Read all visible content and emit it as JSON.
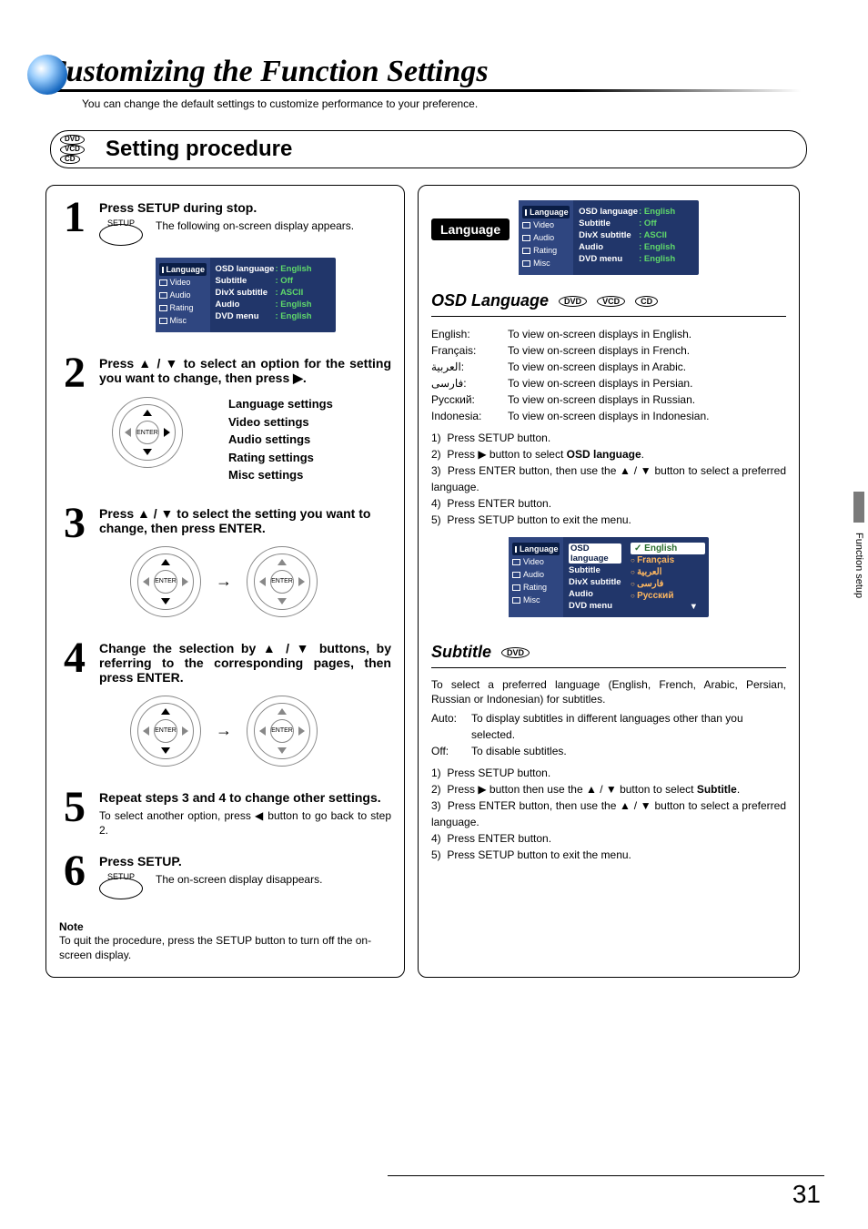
{
  "page_number": "31",
  "side_tab": "Function setup",
  "heading": {
    "title": "Customizing the Function Settings",
    "subtitle": "You can change the default settings to customize performance to your preference.",
    "section": "Setting procedure",
    "disc_types": [
      "DVD",
      "VCD",
      "CD"
    ]
  },
  "left_column": {
    "step1": {
      "num": "1",
      "title": "Press SETUP during stop.",
      "text": "The following on-screen display appears.",
      "btn_label": "SETUP"
    },
    "step2": {
      "num": "2",
      "title": "Press ▲ / ▼ to select an option for the setting you want to change, then press ▶.",
      "list": [
        "Language settings",
        "Video settings",
        "Audio settings",
        "Rating settings",
        "Misc settings"
      ]
    },
    "step3": {
      "num": "3",
      "title": "Press ▲ / ▼ to select the setting you want to change, then press ENTER."
    },
    "step4": {
      "num": "4",
      "title": "Change the selection by ▲ / ▼ buttons, by referring to the corresponding pages, then press ENTER."
    },
    "step5": {
      "num": "5",
      "title": "Repeat steps 3 and 4 to change other settings.",
      "text": "To select another option, press ◀ button to go back to step 2."
    },
    "step6": {
      "num": "6",
      "title": "Press SETUP.",
      "text": "The on-screen display disappears.",
      "btn_label": "SETUP"
    },
    "note_head": "Note",
    "note_text": "To quit the procedure, press the SETUP button to turn off the on-screen display."
  },
  "osd": {
    "menu": [
      "Language",
      "Video",
      "Audio",
      "Rating",
      "Misc"
    ],
    "rows": [
      {
        "k": "OSD language",
        "v": ": English"
      },
      {
        "k": "Subtitle",
        "v": ": Off"
      },
      {
        "k": "DivX subtitle",
        "v": ": ASCII"
      },
      {
        "k": "Audio",
        "v": ": English"
      },
      {
        "k": "DVD menu",
        "v": ": English"
      }
    ],
    "lang_options": [
      "English",
      "Français",
      "العربية",
      "فارسی",
      "Русский"
    ]
  },
  "right_column": {
    "lang_box": "Language",
    "osd_lang": {
      "heading": "OSD Language",
      "discs": [
        "DVD",
        "VCD",
        "CD"
      ],
      "lines": [
        {
          "k": "English:",
          "v": "To view on-screen displays in English."
        },
        {
          "k": "Français:",
          "v": "To view on-screen displays in French."
        },
        {
          "k": "العربية:",
          "v": "To view on-screen displays in Arabic."
        },
        {
          "k": "فارسی:",
          "v": "To view on-screen displays in Persian."
        },
        {
          "k": "Русский:",
          "v": "To view on-screen displays in Russian."
        },
        {
          "k": "Indonesia:",
          "v": "To view on-screen displays in Indonesian."
        }
      ],
      "steps": [
        "Press SETUP button.",
        "Press ▶ button to select OSD language.",
        "Press ENTER button, then use the ▲ / ▼ button to select a preferred language.",
        "Press ENTER button.",
        "Press SETUP button to exit the menu."
      ]
    },
    "subtitle": {
      "heading": "Subtitle",
      "discs": [
        "DVD"
      ],
      "intro": "To select a preferred language (English, French, Arabic, Persian, Russian or Indonesian) for subtitles.",
      "lines": [
        {
          "k": "Auto:",
          "v": "To display subtitles in different languages other than you selected."
        },
        {
          "k": "Off:",
          "v": "To disable subtitles."
        }
      ],
      "steps": [
        "Press SETUP button.",
        "Press ▶ button then use the ▲ / ▼ button to select Subtitle.",
        "Press ENTER button, then use the ▲ / ▼ button to select a preferred language.",
        "Press ENTER button.",
        "Press SETUP button to exit the menu."
      ]
    }
  }
}
